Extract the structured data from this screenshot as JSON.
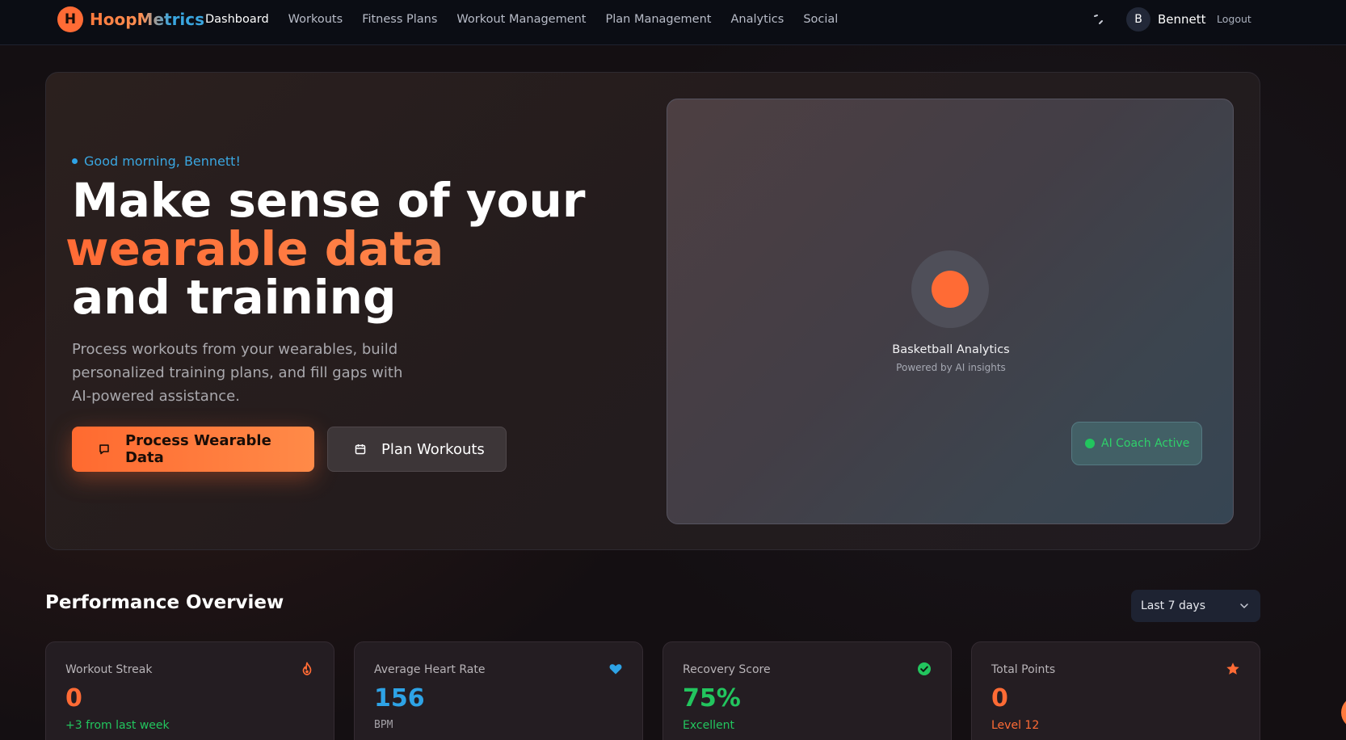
{
  "nav": {
    "brand_initial": "H",
    "brand_name": "HoopMetrics",
    "links": [
      {
        "label": "Dashboard",
        "active": true
      },
      {
        "label": "Workouts"
      },
      {
        "label": "Fitness Plans"
      },
      {
        "label": "Workout Management"
      },
      {
        "label": "Plan Management"
      },
      {
        "label": "Analytics"
      },
      {
        "label": "Social"
      }
    ],
    "avatar_initial": "B",
    "user_name": "Bennett",
    "logout_label": "Logout"
  },
  "hero": {
    "greeting": "Good morning, Bennett!",
    "headline_line1": "Make sense of your",
    "headline_accent": "wearable data",
    "headline_line3": "and training",
    "description": "Process workouts from your wearables, build personalized training plans, and fill gaps with AI-powered assistance.",
    "primary_button": "Process Wearable Data",
    "secondary_button": "Plan Workouts",
    "visual_title": "Basketball Analytics",
    "visual_subtitle": "Powered by AI insights",
    "ai_badge": "AI Coach Active"
  },
  "performance": {
    "title": "Performance Overview",
    "range_selected": "Last 7 days",
    "stats": [
      {
        "label": "Workout Streak",
        "value": "0",
        "sub": "+3 from last week",
        "icon": "flame-icon"
      },
      {
        "label": "Average Heart Rate",
        "value": "156",
        "sub": "BPM",
        "icon": "heart-icon"
      },
      {
        "label": "Recovery Score",
        "value": "75%",
        "sub": "Excellent",
        "icon": "check-circle-icon"
      },
      {
        "label": "Total Points",
        "value": "0",
        "sub": "Level 12",
        "icon": "star-icon"
      }
    ]
  },
  "colors": {
    "accent_orange": "#ff6b35",
    "accent_blue": "#2ea3e6",
    "success_green": "#22c55e"
  }
}
